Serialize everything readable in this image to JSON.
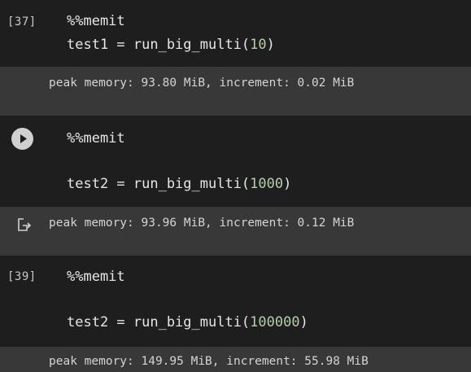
{
  "cells": [
    {
      "prompt": "[37]",
      "line1": "%%memit",
      "line2_prefix": "test1 = run_big_multi(",
      "line2_arg": "10",
      "line2_suffix": ")",
      "output": "peak memory: 93.80 MiB, increment: 0.02 MiB"
    },
    {
      "run_icon": "play-icon",
      "line1": "%%memit",
      "line2_prefix": "test2 = run_big_multi(",
      "line2_arg": "1000",
      "line2_suffix": ")",
      "output_icon": "output-arrow-icon",
      "output": "peak memory: 93.96 MiB, increment: 0.12 MiB"
    },
    {
      "prompt": "[39]",
      "line1": "%%memit",
      "line2_prefix": "test2 = run_big_multi(",
      "line2_arg": "100000",
      "line2_suffix": ")",
      "output": "peak memory: 149.95 MiB, increment: 55.98 MiB"
    }
  ],
  "colors": {
    "code_bg": "#1e1e1e",
    "output_bg": "#383838",
    "number": "#b5cea8"
  }
}
